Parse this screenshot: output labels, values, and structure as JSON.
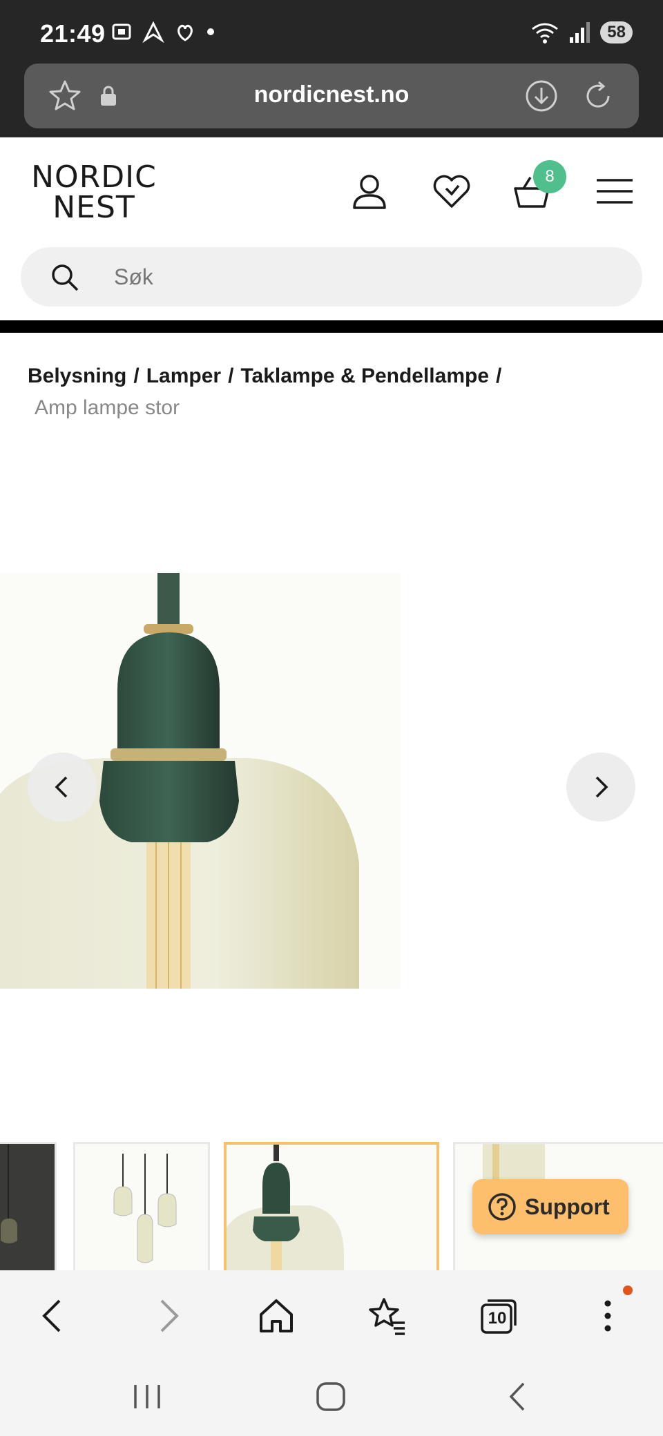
{
  "status_bar": {
    "time": "21:49",
    "battery": "58",
    "icons_left": [
      "screenshot-icon",
      "nav-icon",
      "app-icon",
      "dot-icon"
    ],
    "icons_right": [
      "wifi-icon",
      "signal-icon",
      "battery-icon"
    ]
  },
  "browser": {
    "url": "nordicnest.no",
    "tabs_count": "10"
  },
  "header": {
    "logo_line1": "NORDIC",
    "logo_line2": "NEST",
    "cart_count": "8"
  },
  "search": {
    "placeholder": "Søk"
  },
  "breadcrumb": {
    "items": [
      "Belysning",
      "Lamper",
      "Taklampe & Pendellampe"
    ],
    "separator": "/",
    "current": "Amp lampe stor"
  },
  "support": {
    "label": "Support"
  },
  "colors": {
    "accent_badge": "#4fc08d",
    "support_button": "#fdbf6b",
    "active_thumb_border": "#f4c06e"
  }
}
